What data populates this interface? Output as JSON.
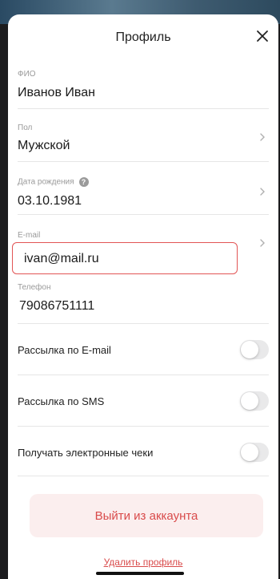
{
  "header": {
    "title": "Профиль"
  },
  "fields": {
    "name": {
      "label": "ФИО",
      "value": "Иванов Иван"
    },
    "gender": {
      "label": "Пол",
      "value": "Мужской"
    },
    "birthdate": {
      "label": "Дата рождения",
      "help": "?",
      "value": "03.10.1981"
    },
    "email": {
      "label": "E-mail",
      "value": "ivan@mail.ru"
    },
    "phone": {
      "label": "Телефон",
      "value": "79086751111"
    }
  },
  "toggles": {
    "email_newsletter": {
      "label": "Рассылка по E-mail",
      "on": false
    },
    "sms_newsletter": {
      "label": "Рассылка по SMS",
      "on": false
    },
    "e_receipts": {
      "label": "Получать электронные чеки",
      "on": false
    }
  },
  "actions": {
    "logout": "Выйти из аккаунта",
    "delete_profile": "Удалить профиль"
  },
  "colors": {
    "accent_red": "#d94b4b",
    "logout_bg": "#fbeeee",
    "highlight_border": "#e25555"
  },
  "icons": [
    "close-icon",
    "chevron-right-icon",
    "help-icon"
  ]
}
